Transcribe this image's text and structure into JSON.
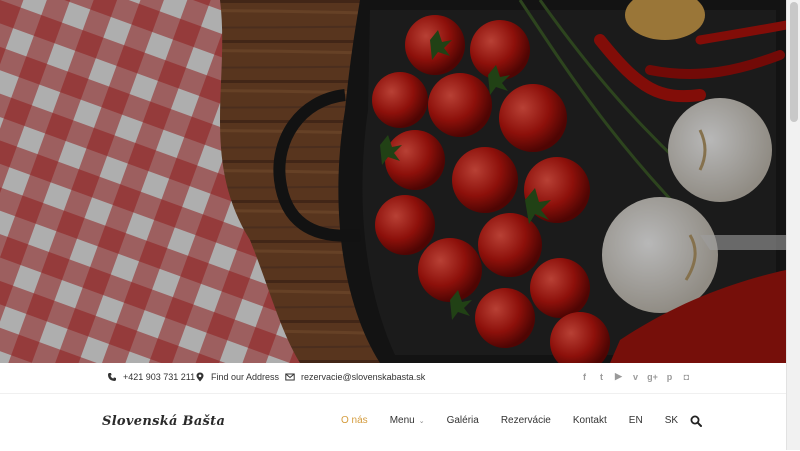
{
  "hero": {
    "alt_theme": "cherry tomatoes, garlic, chili peppers and rosemary in a cast iron pan on a wooden table with a red checkered cloth"
  },
  "topbar": {
    "phone": "+421 903 731 211",
    "address": "Find our Address",
    "email": "rezervacie@slovenskabasta.sk",
    "icons": {
      "phone": "phone-icon",
      "address": "location-pin-icon",
      "email": "envelope-icon"
    },
    "socials": [
      {
        "name": "facebook-icon",
        "glyph": "f"
      },
      {
        "name": "twitter-icon",
        "glyph": "t"
      },
      {
        "name": "youtube-icon",
        "glyph": "▶"
      },
      {
        "name": "vimeo-icon",
        "glyph": "v"
      },
      {
        "name": "google-plus-icon",
        "glyph": "g+"
      },
      {
        "name": "pinterest-icon",
        "glyph": "p"
      },
      {
        "name": "instagram-icon",
        "glyph": "◘"
      }
    ]
  },
  "nav": {
    "logo": "Slovenská Bašta",
    "items": [
      {
        "label": "O nás",
        "active": true
      },
      {
        "label": "Menu",
        "dropdown": true
      },
      {
        "label": "Galéria"
      },
      {
        "label": "Rezervácie"
      },
      {
        "label": "Kontakt"
      },
      {
        "label": "EN"
      },
      {
        "label": "SK"
      }
    ],
    "accent": "#d49b3c",
    "search_icon": "search-icon"
  }
}
